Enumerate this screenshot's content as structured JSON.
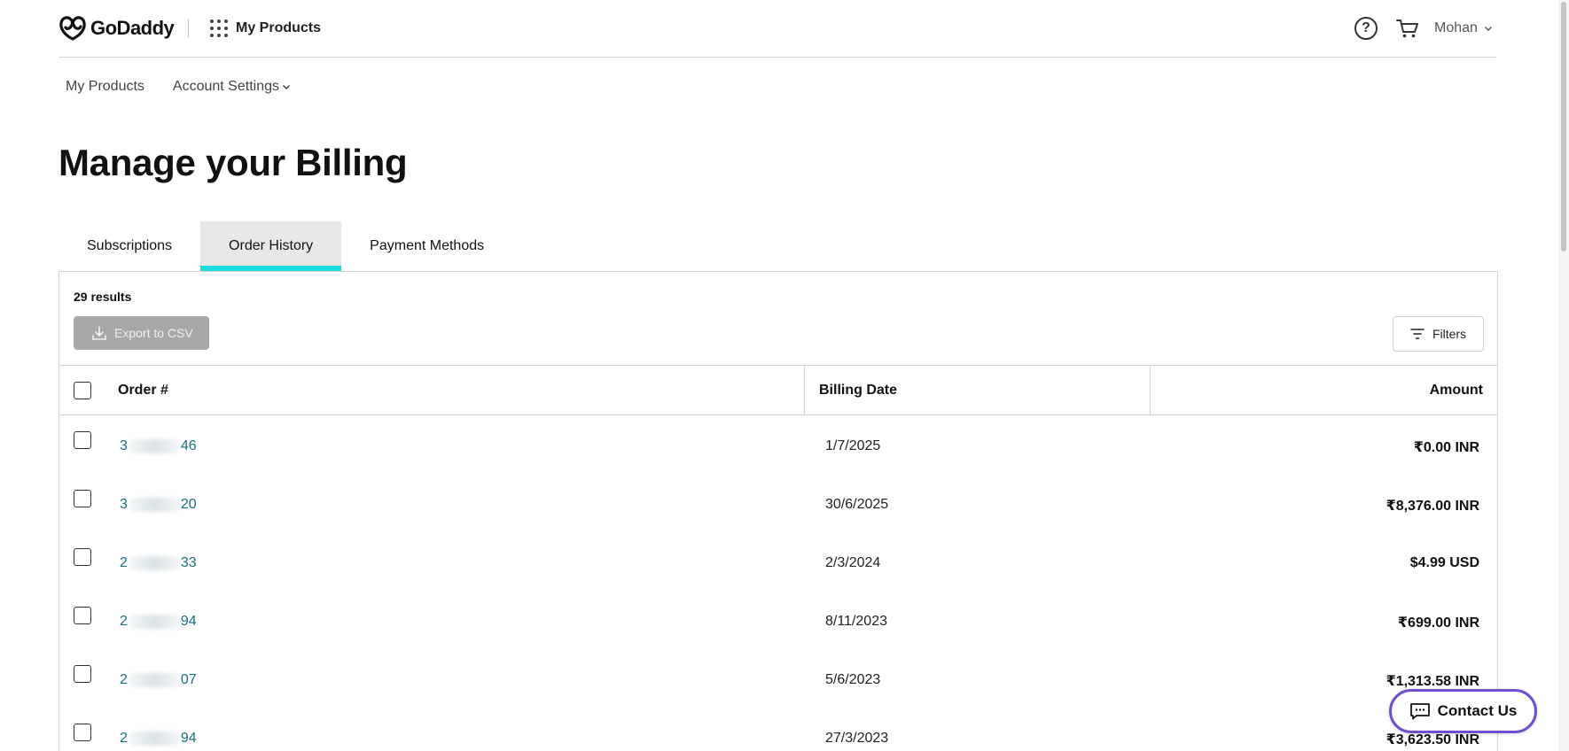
{
  "header": {
    "brand": "GoDaddy",
    "apps_label": "My Products",
    "user_name": "Mohan",
    "help_glyph": "?"
  },
  "subnav": {
    "items": [
      {
        "label": "My Products"
      },
      {
        "label": "Account Settings",
        "has_dropdown": true
      }
    ]
  },
  "page": {
    "title": "Manage your Billing"
  },
  "tabs": [
    {
      "label": "Subscriptions",
      "active": false
    },
    {
      "label": "Order History",
      "active": true
    },
    {
      "label": "Payment Methods",
      "active": false
    }
  ],
  "panel": {
    "results_count": "29 results",
    "export_label": "Export to CSV",
    "export_disabled": true,
    "filters_label": "Filters"
  },
  "table": {
    "columns": [
      "Order #",
      "Billing Date",
      "Amount"
    ],
    "rows": [
      {
        "order_prefix": "3",
        "order_suffix": "46",
        "date": "1/7/2025",
        "amount": "₹0.00 INR"
      },
      {
        "order_prefix": "3",
        "order_suffix": "20",
        "date": "30/6/2025",
        "amount": "₹8,376.00 INR"
      },
      {
        "order_prefix": "2",
        "order_suffix": "33",
        "date": "2/3/2024",
        "amount": "$4.99 USD"
      },
      {
        "order_prefix": "2",
        "order_suffix": "94",
        "date": "8/11/2023",
        "amount": "₹699.00 INR"
      },
      {
        "order_prefix": "2",
        "order_suffix": "07",
        "date": "5/6/2023",
        "amount": "₹1,313.58 INR"
      },
      {
        "order_prefix": "2",
        "order_suffix": "94",
        "date": "27/3/2023",
        "amount": "₹3,623.50 INR"
      }
    ]
  },
  "contact": {
    "label": "Contact Us"
  },
  "colors": {
    "accent_tab": "#1bdbdb",
    "link": "#1a6e80",
    "contact_border": "#6f4fcf",
    "export_disabled_bg": "#a8a8a8"
  },
  "icons": {
    "logo": "godaddy-logo-icon",
    "apps": "apps-grid-icon",
    "help": "help-icon",
    "cart": "cart-icon",
    "chevron": "chevron-down-icon",
    "download": "download-icon",
    "filter": "filter-icon",
    "chat": "chat-icon"
  }
}
